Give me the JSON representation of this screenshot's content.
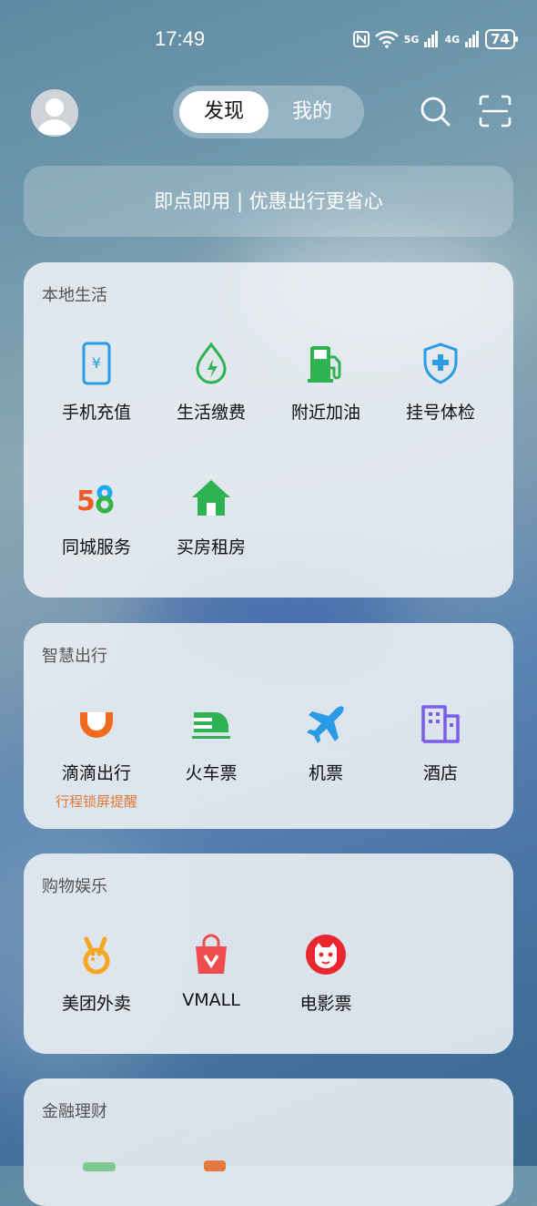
{
  "status": {
    "time": "17:49",
    "battery": "74",
    "net1": "5G",
    "net2": "4G"
  },
  "header": {
    "tabs": [
      {
        "label": "发现"
      },
      {
        "label": "我的"
      }
    ]
  },
  "banner": {
    "text": "即点即用 | 优惠出行更省心"
  },
  "sections": [
    {
      "title": "本地生活",
      "items": [
        {
          "label": "手机充值",
          "icon": "phone-recharge-icon"
        },
        {
          "label": "生活缴费",
          "icon": "utility-bill-icon"
        },
        {
          "label": "附近加油",
          "icon": "gas-station-icon"
        },
        {
          "label": "挂号体检",
          "icon": "medical-shield-icon"
        },
        {
          "label": "同城服务",
          "icon": "58-logo-icon"
        },
        {
          "label": "买房租房",
          "icon": "house-icon"
        }
      ]
    },
    {
      "title": "智慧出行",
      "items": [
        {
          "label": "滴滴出行",
          "sub": "行程锁屏提醒",
          "icon": "didi-icon"
        },
        {
          "label": "火车票",
          "icon": "train-icon"
        },
        {
          "label": "机票",
          "icon": "airplane-icon"
        },
        {
          "label": "酒店",
          "icon": "hotel-icon"
        }
      ]
    },
    {
      "title": "购物娱乐",
      "items": [
        {
          "label": "美团外卖",
          "icon": "meituan-icon"
        },
        {
          "label": "VMALL",
          "icon": "vmall-bag-icon"
        },
        {
          "label": "电影票",
          "icon": "movie-cat-icon"
        }
      ]
    },
    {
      "title": "金融理财",
      "items": []
    }
  ]
}
